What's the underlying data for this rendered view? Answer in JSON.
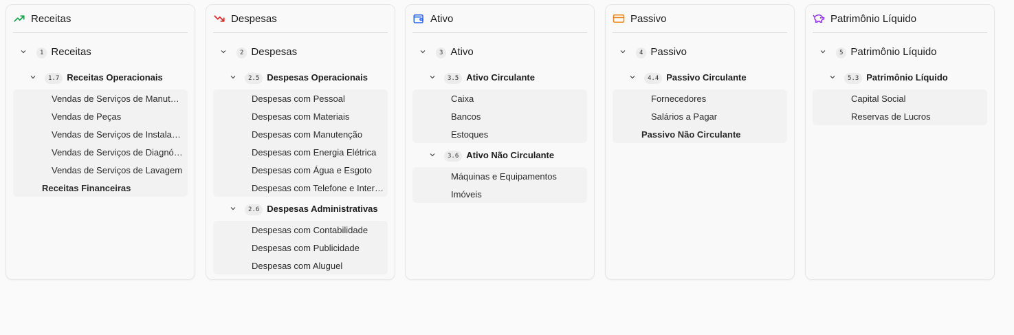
{
  "colors": {
    "receitas": "#16a34a",
    "despesas": "#dc2626",
    "ativo": "#2563eb",
    "passivo": "#ea8a1a",
    "patrimonio": "#9333ea"
  },
  "receitas": {
    "header": "Receitas",
    "icon": "trending-up-icon",
    "root": {
      "code": "1",
      "label": "Receitas"
    },
    "groups": [
      {
        "code": "1.7",
        "label": "Receitas Operacionais",
        "items": [
          "Vendas de Serviços de Manutenção",
          "Vendas de Peças",
          "Vendas de Serviços de Instalação",
          "Vendas de Serviços de Diagnóstico",
          "Vendas de Serviços de Lavagem"
        ]
      }
    ],
    "extra": "Receitas Financeiras"
  },
  "despesas": {
    "header": "Despesas",
    "icon": "trending-down-icon",
    "root": {
      "code": "2",
      "label": "Despesas"
    },
    "groups": [
      {
        "code": "2.5",
        "label": "Despesas Operacionais",
        "items": [
          "Despesas com Pessoal",
          "Despesas com Materiais",
          "Despesas com Manutenção",
          "Despesas com Energia Elétrica",
          "Despesas com Água e Esgoto",
          "Despesas com Telefone e Internet"
        ]
      },
      {
        "code": "2.6",
        "label": "Despesas Administrativas",
        "items": [
          "Despesas com Contabilidade",
          "Despesas com Publicidade",
          "Despesas com Aluguel"
        ]
      }
    ]
  },
  "ativo": {
    "header": "Ativo",
    "icon": "wallet-icon",
    "root": {
      "code": "3",
      "label": "Ativo"
    },
    "groups": [
      {
        "code": "3.5",
        "label": "Ativo Circulante",
        "items": [
          "Caixa",
          "Bancos",
          "Estoques"
        ]
      },
      {
        "code": "3.6",
        "label": "Ativo Não Circulante",
        "items": [
          "Máquinas e Equipamentos",
          "Imóveis"
        ]
      }
    ]
  },
  "passivo": {
    "header": "Passivo",
    "icon": "credit-card-icon",
    "root": {
      "code": "4",
      "label": "Passivo"
    },
    "groups": [
      {
        "code": "4.4",
        "label": "Passivo Circulante",
        "items": [
          "Fornecedores",
          "Salários a Pagar"
        ]
      }
    ],
    "extra": "Passivo Não Circulante"
  },
  "patrimonio": {
    "header": "Patrimônio Líquido",
    "icon": "piggy-bank-icon",
    "root": {
      "code": "5",
      "label": "Patrimônio Líquido"
    },
    "groups": [
      {
        "code": "5.3",
        "label": "Patrimônio Líquido",
        "items": [
          "Capital Social",
          "Reservas de Lucros"
        ]
      }
    ]
  }
}
